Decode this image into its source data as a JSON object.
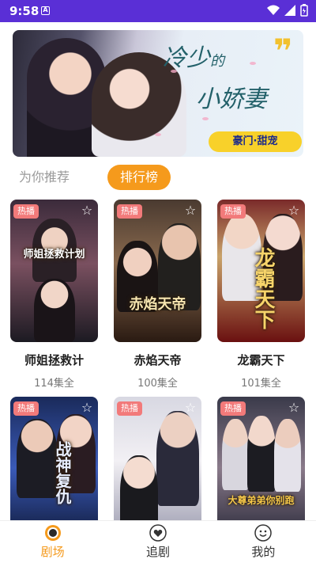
{
  "status": {
    "time": "9:58",
    "notif_letter": "A"
  },
  "banner": {
    "title_part1": "冷少",
    "title_small": "的",
    "title_part2": "小娇妻",
    "quote_mark": "❞",
    "tag": "豪门·甜宠"
  },
  "tabs": [
    {
      "label": "为你推荐",
      "active": false
    },
    {
      "label": "排行榜",
      "active": true
    }
  ],
  "cards": [
    {
      "name": "师姐拯救计",
      "eps": "114集全",
      "badge": "热播",
      "poster_text": "师姐拯救计划",
      "colors": [
        "#3b2b3b",
        "#7a5060",
        "#1c1a22"
      ]
    },
    {
      "name": "赤焰天帝",
      "eps": "100集全",
      "badge": "热播",
      "poster_text": "赤焰天帝",
      "colors": [
        "#5a3a28",
        "#c88a4e",
        "#2a1a12"
      ]
    },
    {
      "name": "龙霸天下",
      "eps": "101集全",
      "badge": "热播",
      "poster_text": "龙霸天下",
      "colors": [
        "#5c1a1a",
        "#c9a36a",
        "#6a1010"
      ]
    },
    {
      "name": "战神复仇",
      "eps": "",
      "badge": "热播",
      "poster_text": "战神复仇",
      "colors": [
        "#1a2a5a",
        "#4a6ac8",
        "#101a3a"
      ]
    },
    {
      "name": "",
      "eps": "",
      "badge": "热播",
      "poster_text": "",
      "colors": [
        "#c8c8d8",
        "#f0eef2",
        "#8a8aa0"
      ]
    },
    {
      "name": "大尊弟弟你别跑",
      "eps": "",
      "badge": "热播",
      "poster_text": "大尊弟弟你别跑",
      "colors": [
        "#2a2a3a",
        "#b88a6a",
        "#e8c050"
      ]
    }
  ],
  "nav": [
    {
      "label": "剧场",
      "icon": "theater-icon",
      "active": true
    },
    {
      "label": "追剧",
      "icon": "heart-icon",
      "active": false
    },
    {
      "label": "我的",
      "icon": "profile-icon",
      "active": false
    }
  ],
  "accent": "#f59a1c",
  "statusbar_color": "#5a2fd6"
}
